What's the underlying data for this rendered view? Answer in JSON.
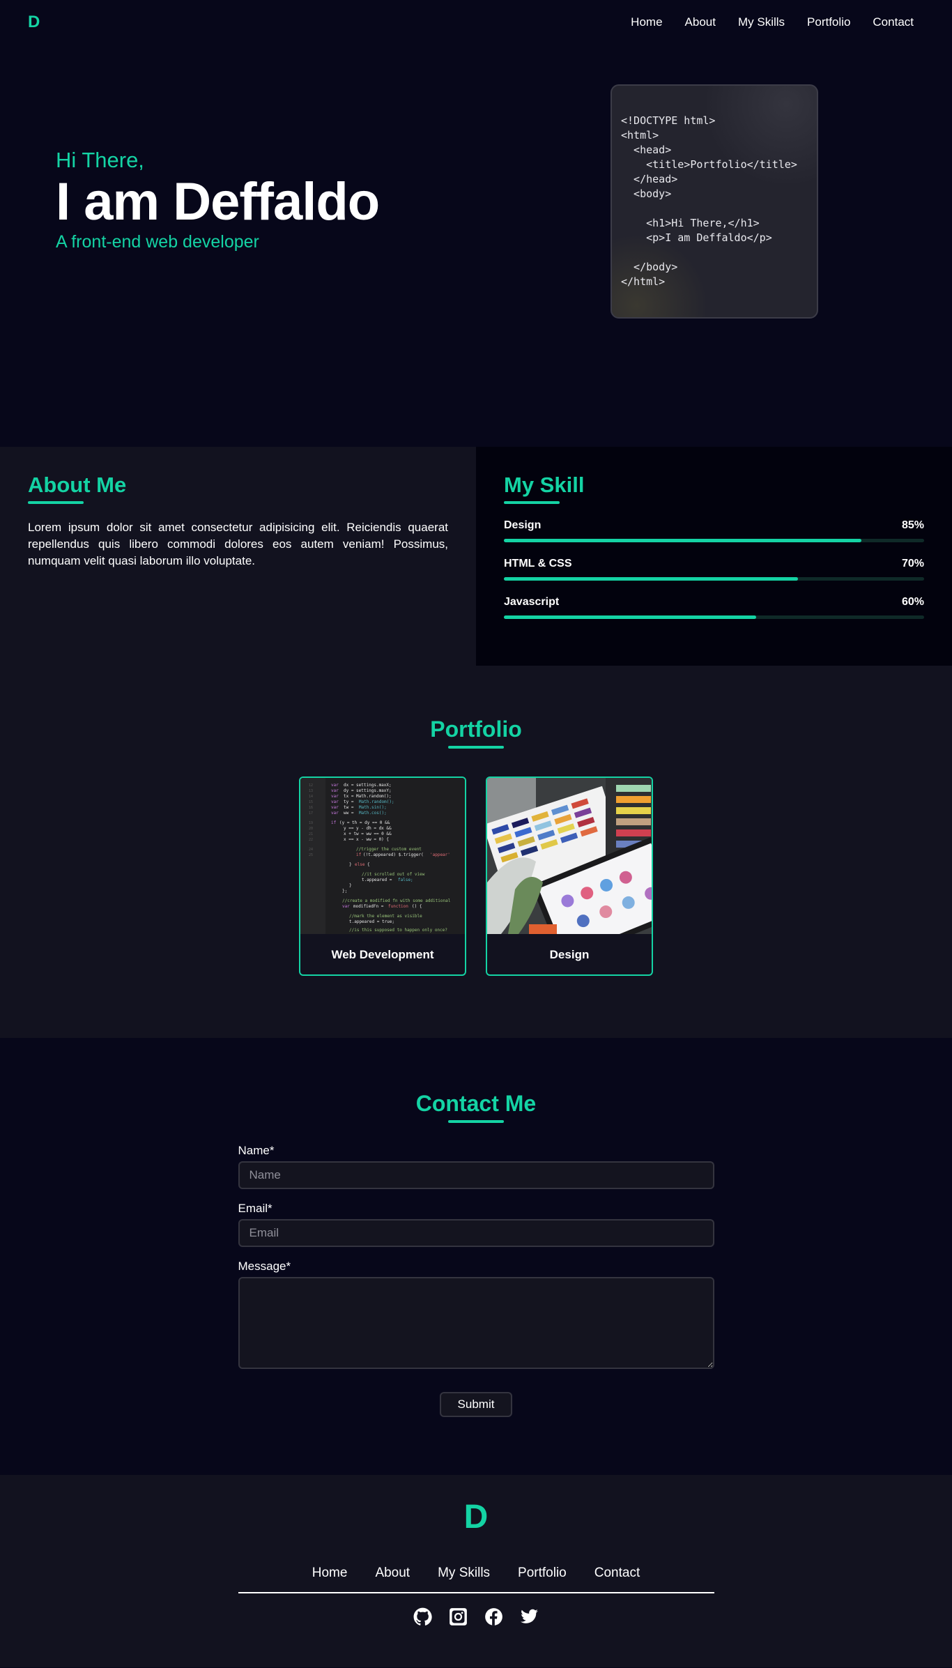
{
  "nav": {
    "logo": "D",
    "links": [
      "Home",
      "About",
      "My Skills",
      "Portfolio",
      "Contact"
    ]
  },
  "hero": {
    "greeting": "Hi There,",
    "name": "I am Deffaldo",
    "role": "A front-end web developer",
    "code_snippet": "<!DOCTYPE html>\n<html>\n  <head>\n    <title>Portfolio</title>\n  </head>\n  <body>\n\n    <h1>Hi There,</h1>\n    <p>I am Deffaldo</p>\n\n  </body>\n</html>"
  },
  "about": {
    "title": "About Me",
    "text": "Lorem ipsum dolor sit amet consectetur adipisicing elit. Reiciendis quaerat repellendus quis libero commodi dolores eos autem veniam! Possimus, numquam velit quasi laborum illo voluptate."
  },
  "skills": {
    "title": "My Skill",
    "items": [
      {
        "name": "Design",
        "percent_label": "85%",
        "value": 0.85
      },
      {
        "name": "HTML & CSS",
        "percent_label": "70%",
        "value": 0.7
      },
      {
        "name": "Javascript",
        "percent_label": "60%",
        "value": 0.6
      }
    ]
  },
  "portfolio": {
    "title": "Portfolio",
    "cards": [
      {
        "label": "Web Development",
        "image": "code-screenshot"
      },
      {
        "label": "Design",
        "image": "color-swatches"
      }
    ]
  },
  "contact": {
    "title": "Contact Me",
    "name_label": "Name*",
    "name_placeholder": "Name",
    "email_label": "Email*",
    "email_placeholder": "Email",
    "message_label": "Message*",
    "submit_label": "Submit"
  },
  "footer": {
    "logo": "D",
    "links": [
      "Home",
      "About",
      "My Skills",
      "Portfolio",
      "Contact"
    ],
    "socials": [
      "github-icon",
      "instagram-icon",
      "facebook-icon",
      "twitter-icon"
    ]
  },
  "colors": {
    "accent": "#14d3a4",
    "background": "#07071a",
    "panel": "#12121f"
  }
}
